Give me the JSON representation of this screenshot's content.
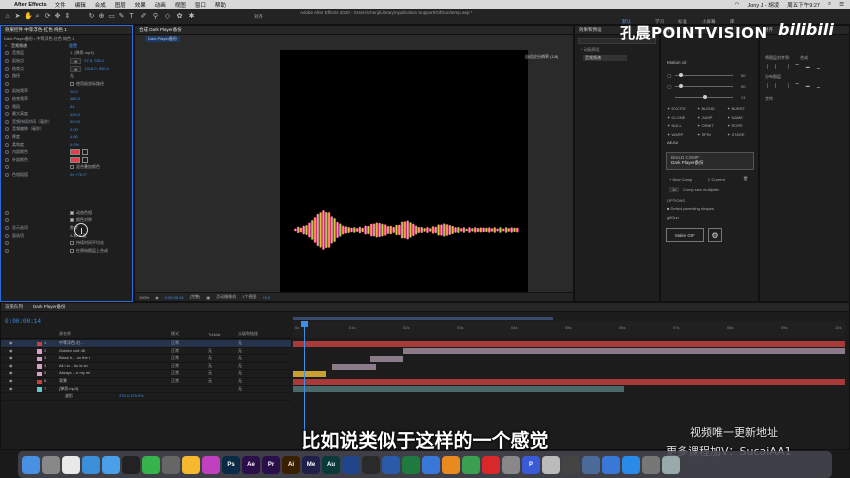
{
  "menubar": {
    "app": "After Effects",
    "items": [
      "文件",
      "编辑",
      "合成",
      "图层",
      "效果",
      "动画",
      "视图",
      "窗口",
      "帮助"
    ],
    "user": "Jony J - 胡凌",
    "clock": "周五下午9:27"
  },
  "toolbar": {
    "window_title": "Adobe After Effects 2020 - /Users/chenj/Library/Application Support/GifGun/temp.aep *",
    "snap_label": "对齐",
    "workspaces": [
      {
        "label": "默认",
        "active": true
      },
      {
        "label": "学习",
        "active": false
      },
      {
        "label": "标准",
        "active": false
      },
      {
        "label": "小屏幕",
        "active": false
      },
      {
        "label": "库",
        "active": false
      }
    ]
  },
  "effects_panel": {
    "tab": "效果控件 中等浮色-红色 纯色 1",
    "subtitle": "Dark Player备份 • 中等浮色-红色 纯色 1",
    "effect_name": "音频频谱",
    "reset_label": "重置",
    "rows": [
      {
        "name": "音频层",
        "value": "1. [弹男.mp3]",
        "kind": "dropdown"
      },
      {
        "name": "起始点",
        "value": "57.5, 530.0",
        "kind": "point"
      },
      {
        "name": "结束点",
        "value": "1016.0, 530.0",
        "kind": "point"
      },
      {
        "name": "路径",
        "value": "无",
        "kind": "dropdown"
      },
      {
        "name": "",
        "value": "使用极坐标路径",
        "kind": "checkbox"
      },
      {
        "name": "起始频率",
        "value": "20.0",
        "kind": "num"
      },
      {
        "name": "结束频率",
        "value": "480.0",
        "kind": "num"
      },
      {
        "name": "频段",
        "value": "64",
        "kind": "num"
      },
      {
        "name": "最大高度",
        "value": "400.0",
        "kind": "num"
      },
      {
        "name": "音频持续时间（毫秒）",
        "value": "90.00",
        "kind": "num"
      },
      {
        "name": "音频偏移（毫秒）",
        "value": "0.00",
        "kind": "num"
      },
      {
        "name": "厚度",
        "value": "4.80",
        "kind": "num"
      },
      {
        "name": "柔和度",
        "value": "0.0%",
        "kind": "num"
      },
      {
        "name": "内部颜色",
        "value": "",
        "kind": "color"
      },
      {
        "name": "外部颜色",
        "value": "",
        "kind": "color"
      },
      {
        "name": "",
        "value": "混合叠加颜色",
        "kind": "checkbox"
      },
      {
        "name": "色相插值",
        "value": "0x +75.0°",
        "kind": "num"
      },
      {
        "name": "",
        "value": "",
        "kind": "spacer"
      },
      {
        "name": "",
        "value": "",
        "kind": "spacer"
      },
      {
        "name": "",
        "value": "",
        "kind": "spacer"
      },
      {
        "name": "",
        "value": "",
        "kind": "spacer"
      },
      {
        "name": "",
        "value": "动态色相",
        "kind": "checkbox-on"
      },
      {
        "name": "",
        "value": "颜色对称",
        "kind": "checkbox-on"
      },
      {
        "name": "显示选项",
        "value": "数字",
        "kind": "dropdown"
      },
      {
        "name": "面选项",
        "value": "A 和 B 面",
        "kind": "dropdown"
      },
      {
        "name": "",
        "value": "持续时间平均化",
        "kind": "checkbox"
      },
      {
        "name": "",
        "value": "在原始图层上合成",
        "kind": "checkbox"
      }
    ]
  },
  "comp_panel": {
    "tab": "合成 Dark Player备份",
    "breadcrumb": "Dark Player备份",
    "resolution_label": "自适应分辨率 (1/8)",
    "footer": [
      "100%",
      "0:00:00:14",
      "(完整)",
      "活动摄像机",
      "1个视图",
      "+0.0"
    ]
  },
  "fx_preset_panel": {
    "tab": "效果和预设",
    "tree_root": "* 动画预设",
    "selected": "音频频谱"
  },
  "plugin_panel": {
    "tab": "对齐",
    "motion_label": "Motion v2",
    "slider_values": [
      "50",
      "50",
      "74"
    ],
    "buttons": [
      "EXCITE",
      "BLEND",
      "BURST",
      "CLONE",
      "JUMP",
      "NAME",
      "NULL",
      "ORBIT",
      "ROPE",
      "WARP",
      "SPIN",
      "STARE"
    ],
    "aejuice_label": "AEJUI",
    "build_comp_label": "BUILD COMP",
    "build_comp_sub": "Dark Player备份",
    "new_comp": "New Comp",
    "current": "Current",
    "multiplier_value": "1x",
    "multiplier_label": "Comp size multiplier",
    "options_label": "OPTIONS",
    "detect_label": "Detect parenting shapes",
    "gifgun_label": "gifGun",
    "make_gif": "Make GIF"
  },
  "rightmost_panel": {
    "tabs": [
      "对齐",
      "分布图层"
    ],
    "align_target": "合成",
    "char_label": "字符"
  },
  "timeline": {
    "tabs": [
      "渲染队列",
      "Dark Player备份"
    ],
    "timecode": "0:00:00:14",
    "headers": [
      "源名称",
      "模式",
      "TrkMat",
      "父级和链接"
    ],
    "ruler_ticks": [
      "0s",
      "01s",
      "02s",
      "03s",
      "04s",
      "05s",
      "06s",
      "07s",
      "08s",
      "09s",
      "10s"
    ],
    "layers": [
      {
        "num": "1",
        "name": "中等浮色-红...",
        "mode": "正常",
        "trk": "",
        "parent": "无",
        "color": "#c84040",
        "bar": [
          0.0,
          1.0
        ],
        "barcolor": "#a83a3a"
      },
      {
        "num": "2",
        "name": "Golden cott 48",
        "mode": "正常",
        "trk": "无",
        "parent": "无",
        "color": "#d8a0c8",
        "bar": [
          0.2,
          1.0
        ],
        "barcolor": "#8a7a8a"
      },
      {
        "num": "3",
        "name": "Black b... on the r",
        "mode": "正常",
        "trk": "无",
        "parent": "无",
        "color": "#d8a0c8",
        "bar": [
          0.14,
          0.2
        ],
        "barcolor": "#8a7a8a"
      },
      {
        "num": "4",
        "name": "All I w... do is sh",
        "mode": "正常",
        "trk": "无",
        "parent": "无",
        "color": "#d8a0c8",
        "bar": [
          0.07,
          0.15
        ],
        "barcolor": "#8a7a8a"
      },
      {
        "num": "5",
        "name": "Always ...e my mi",
        "mode": "正常",
        "trk": "无",
        "parent": "无",
        "color": "#d8a0c8",
        "bar": [
          0.0,
          0.06
        ],
        "barcolor": "#c8a030"
      },
      {
        "num": "6",
        "name": "背景",
        "mode": "正常",
        "trk": "无",
        "parent": "无",
        "color": "#c84040",
        "bar": [
          0.0,
          1.0
        ],
        "barcolor": "#a83a3a"
      },
      {
        "num": "7",
        "name": "[弹男.mp3]",
        "mode": "",
        "trk": "",
        "parent": "无",
        "color": "#66c8c8",
        "bar": [
          0.0,
          0.6
        ],
        "barcolor": "#4a6a6a"
      }
    ],
    "sublayer_label": "波形",
    "sublayer_value": "375.0,375.0%"
  },
  "subtitle": "比如说类似于这样的一个感觉",
  "watermark": {
    "line1": "视频唯一更新地址",
    "line2": "更多课程加V：SucaiAA1",
    "brand": "孔晨POINTVISION",
    "brand2": "bilibili"
  },
  "dock": {
    "icons": [
      {
        "name": "finder",
        "label": "",
        "color": "#4a90e2"
      },
      {
        "name": "launchpad",
        "label": "",
        "color": "#888"
      },
      {
        "name": "chrome",
        "label": "",
        "color": "#e8e8e8"
      },
      {
        "name": "maps",
        "label": "",
        "color": "#3a8fd8"
      },
      {
        "name": "safari",
        "label": "",
        "color": "#4aa0e8"
      },
      {
        "name": "qq",
        "label": "",
        "color": "#222"
      },
      {
        "name": "wechat",
        "label": "",
        "color": "#36b34a"
      },
      {
        "name": "notes",
        "label": "",
        "color": "#666"
      },
      {
        "name": "sketch",
        "label": "",
        "color": "#f5b82e"
      },
      {
        "name": "picsart",
        "label": "",
        "color": "#c040c0"
      },
      {
        "name": "photoshop",
        "label": "Ps",
        "color": "#0b2a45"
      },
      {
        "name": "after-effects",
        "label": "Ae",
        "color": "#2a0f4a"
      },
      {
        "name": "premiere",
        "label": "Pr",
        "color": "#2a0f4a"
      },
      {
        "name": "illustrator",
        "label": "Ai",
        "color": "#3a1f00"
      },
      {
        "name": "media-encoder",
        "label": "Me",
        "color": "#1f1f4a"
      },
      {
        "name": "audition",
        "label": "Au",
        "color": "#0a3a3a"
      },
      {
        "name": "c4d",
        "label": "",
        "color": "#224488"
      },
      {
        "name": "lightroom",
        "label": "",
        "color": "#2a2a2a"
      },
      {
        "name": "word",
        "label": "",
        "color": "#2a5aa8"
      },
      {
        "name": "excel",
        "label": "",
        "color": "#1f7a3f"
      },
      {
        "name": "keynote",
        "label": "",
        "color": "#3a78d8"
      },
      {
        "name": "infuse",
        "label": "",
        "color": "#e88a20"
      },
      {
        "name": "iina",
        "label": "",
        "color": "#3aa050"
      },
      {
        "name": "netease-music",
        "label": "",
        "color": "#d8282a"
      },
      {
        "name": "typora",
        "label": "",
        "color": "#888"
      },
      {
        "name": "pages",
        "label": "P",
        "color": "#3a5ad8"
      },
      {
        "name": "vpn",
        "label": "",
        "color": "#bbb"
      },
      {
        "name": "music",
        "label": "",
        "color": "#444"
      },
      {
        "name": "downloads",
        "label": "",
        "color": "#4a6a9a"
      },
      {
        "name": "screenshots",
        "label": "",
        "color": "#3a78d8"
      },
      {
        "name": "app-store",
        "label": "",
        "color": "#2a8ae8"
      },
      {
        "name": "system-prefs",
        "label": "",
        "color": "#777"
      },
      {
        "name": "trash",
        "label": "",
        "color": "#9aa"
      }
    ]
  }
}
